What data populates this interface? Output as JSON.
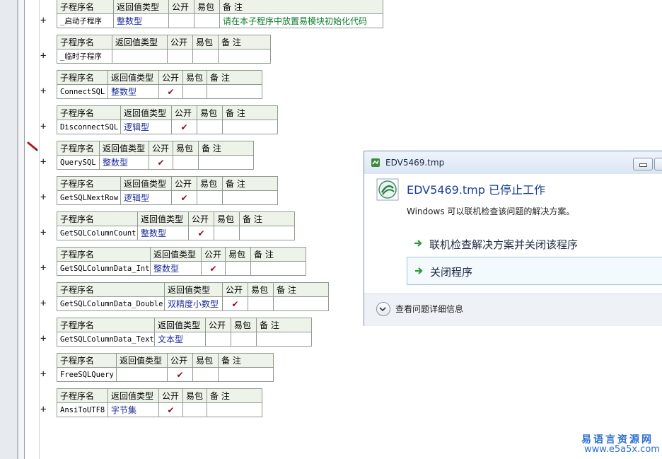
{
  "headers": {
    "name": "子程序名",
    "ret": "返回值类型",
    "pub": "公开",
    "pkg": "易包",
    "note": "备 注"
  },
  "subs": [
    {
      "name": "_启动子程序",
      "type": "整数型",
      "pub": "",
      "note": "请在本子程序中放置易模块初始化代码"
    },
    {
      "name": "_临时子程序",
      "type": "",
      "pub": "",
      "note": ""
    },
    {
      "name": "ConnectSQL",
      "type": "整数型",
      "pub": "✔",
      "note": ""
    },
    {
      "name": "DisconnectSQL",
      "type": "逻辑型",
      "pub": "✔",
      "note": ""
    },
    {
      "name": "QuerySQL",
      "type": "整数型",
      "pub": "✔",
      "note": ""
    },
    {
      "name": "GetSQLNextRow",
      "type": "逻辑型",
      "pub": "✔",
      "note": ""
    },
    {
      "name": "GetSQLColumnCount",
      "type": "整数型",
      "pub": "✔",
      "note": ""
    },
    {
      "name": "GetSQLColumnData_Int",
      "type": "整数型",
      "pub": "✔",
      "note": ""
    },
    {
      "name": "GetSQLColumnData_Double",
      "type": "双精度小数型",
      "pub": "✔",
      "note": ""
    },
    {
      "name": "GetSQLColumnData_Text",
      "type": "文本型",
      "pub": "",
      "note": ""
    },
    {
      "name": "FreeSQLQuery",
      "type": "",
      "pub": "✔",
      "note": ""
    },
    {
      "name": "AnsiToUTF8",
      "type": "字节集",
      "pub": "✔",
      "note": ""
    }
  ],
  "expand_symbol": "+",
  "dialog": {
    "title": "EDV5469.tmp",
    "heading": "EDV5469.tmp 已停止工作",
    "description": "Windows 可以联机检查该问题的解决方案。",
    "option1": "联机检查解决方案并关闭该程序",
    "option2": "关闭程序",
    "details": "查看问题详细信息"
  },
  "watermark": {
    "line1": "易语言资源网",
    "line2": "www.e5a5x.com"
  },
  "colors": {
    "header_bg": "#eef3ea",
    "type_text": "#1a2a9a",
    "note_text": "#0a7a2a",
    "check": "#8a1020",
    "dialog_heading": "#1d3f9a",
    "watermark": "#2b6fd0"
  }
}
